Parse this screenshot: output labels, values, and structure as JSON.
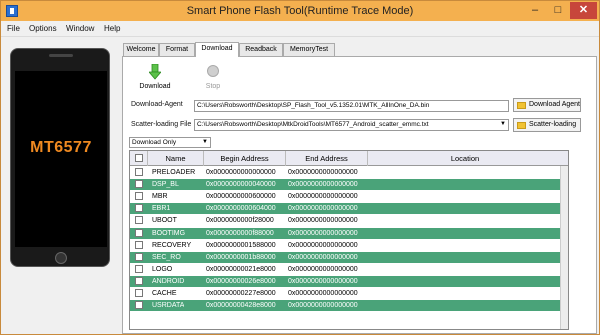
{
  "window": {
    "title": "Smart Phone Flash Tool(Runtime Trace Mode)",
    "min_symbol": "–",
    "max_symbol": "□",
    "close_symbol": "✕"
  },
  "menu": [
    "File",
    "Options",
    "Window",
    "Help"
  ],
  "phone": {
    "model_label": "MT6577"
  },
  "tabs": [
    "Welcome",
    "Format",
    "Download",
    "Readback",
    "MemoryTest"
  ],
  "active_tab": "Download",
  "toolbar": {
    "download_label": "Download",
    "stop_label": "Stop"
  },
  "form": {
    "da_label": "Download-Agent",
    "da_value": "C:\\Users\\Robsworth\\Desktop\\SP_Flash_Tool_v5.1352.01\\MTK_AllInOne_DA.bin",
    "da_button": "Download Agent",
    "scatter_label": "Scatter-loading File",
    "scatter_value": "C:\\Users\\Robsworth\\Desktop\\MtkDroidTools\\MT6577_Android_scatter_emmc.txt",
    "scatter_button": "Scatter-loading",
    "mode_value": "Download Only"
  },
  "table": {
    "headers": [
      "Name",
      "Begin Address",
      "End Address",
      "Location"
    ],
    "rows": [
      {
        "name": "PRELOADER",
        "begin": "0x0000000000000000",
        "end": "0x0000000000000000",
        "location": ""
      },
      {
        "name": "DSP_BL",
        "begin": "0x0000000000040000",
        "end": "0x0000000000000000",
        "location": ""
      },
      {
        "name": "MBR",
        "begin": "0x0000000000600000",
        "end": "0x0000000000000000",
        "location": ""
      },
      {
        "name": "EBR1",
        "begin": "0x0000000000604000",
        "end": "0x0000000000000000",
        "location": ""
      },
      {
        "name": "UBOOT",
        "begin": "0x0000000000f28000",
        "end": "0x0000000000000000",
        "location": ""
      },
      {
        "name": "BOOTIMG",
        "begin": "0x0000000000f88000",
        "end": "0x0000000000000000",
        "location": ""
      },
      {
        "name": "RECOVERY",
        "begin": "0x0000000001588000",
        "end": "0x0000000000000000",
        "location": ""
      },
      {
        "name": "SEC_RO",
        "begin": "0x0000000001b88000",
        "end": "0x0000000000000000",
        "location": ""
      },
      {
        "name": "LOGO",
        "begin": "0x00000000021e8000",
        "end": "0x0000000000000000",
        "location": ""
      },
      {
        "name": "ANDROID",
        "begin": "0x00000000026e8000",
        "end": "0x0000000000000000",
        "location": ""
      },
      {
        "name": "CACHE",
        "begin": "0x00000000227e8000",
        "end": "0x0000000000000000",
        "location": ""
      },
      {
        "name": "USRDATA",
        "begin": "0x00000000428e8000",
        "end": "0x0000000000000000",
        "location": ""
      }
    ]
  },
  "colors": {
    "title_bar": "#f4b04f",
    "stripe": "#4aa379",
    "phone_label": "#f08a21"
  }
}
